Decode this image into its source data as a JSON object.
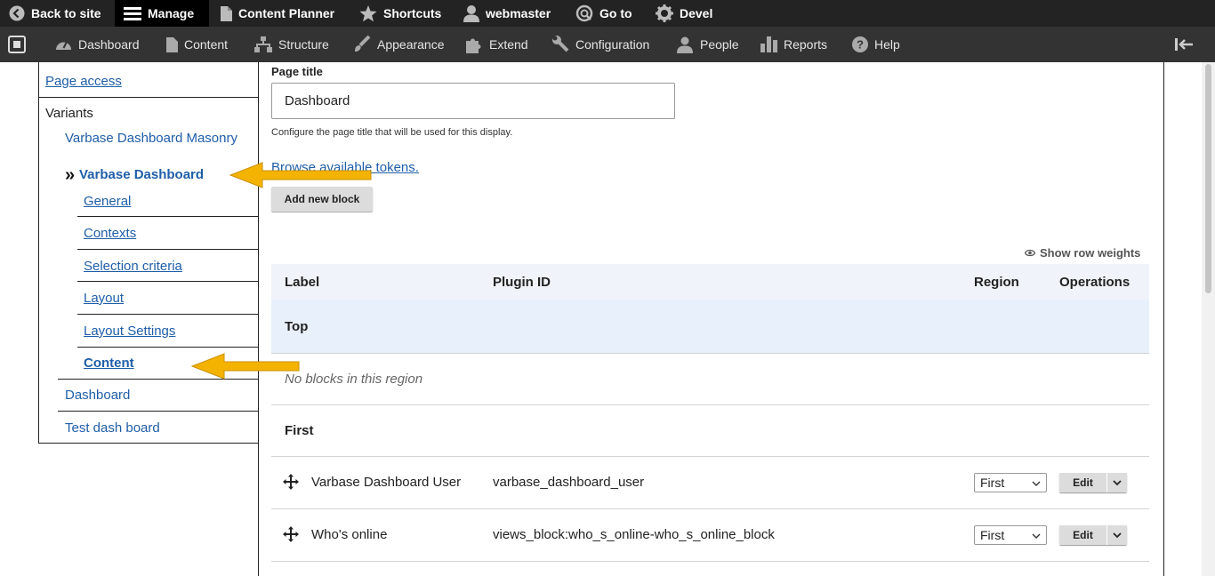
{
  "toolbar": {
    "back_to_site": "Back to site",
    "manage": "Manage",
    "content_planner": "Content Planner",
    "shortcuts": "Shortcuts",
    "user": "webmaster",
    "goto": "Go to",
    "devel": "Devel"
  },
  "tray": {
    "items": [
      "Dashboard",
      "Content",
      "Structure",
      "Appearance",
      "Extend",
      "Configuration",
      "People",
      "Reports",
      "Help"
    ]
  },
  "left_nav": {
    "page_access": "Page access",
    "variants_heading": "Variants",
    "variant_masonry": "Varbase Dashboard Masonry",
    "active_prefix": "»",
    "variant_active": "Varbase Dashboard",
    "sub_items": [
      "General",
      "Contexts",
      "Selection criteria",
      "Layout",
      "Layout Settings",
      "Content"
    ],
    "variant_dashboard": "Dashboard",
    "variant_test": "Test dash board"
  },
  "main": {
    "page_title_label": "Page title",
    "page_title_value": "Dashboard",
    "page_title_help": "Configure the page title that will be used for this display.",
    "browse_tokens": "Browse available tokens.",
    "add_block": "Add new block",
    "show_row_weights": "Show row weights",
    "table": {
      "headers": {
        "label": "Label",
        "plugin_id": "Plugin ID",
        "region": "Region",
        "operations": "Operations"
      },
      "region_top": "Top",
      "no_blocks": "No blocks in this region",
      "region_first": "First",
      "rows": [
        {
          "label": "Varbase Dashboard User",
          "plugin": "varbase_dashboard_user",
          "region": "First",
          "op": "Edit"
        },
        {
          "label": "Who's online",
          "plugin": "views_block:who_s_online-who_s_online_block",
          "region": "First",
          "op": "Edit"
        }
      ]
    }
  },
  "colors": {
    "link": "#1f5ea8",
    "arrow": "#f5b301",
    "toolbar": "#232323",
    "tray": "#333333"
  }
}
